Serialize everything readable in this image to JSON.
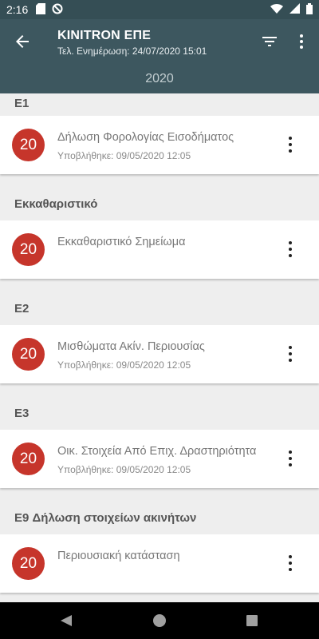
{
  "status_bar": {
    "time": "2:16",
    "icons": [
      "sd-card-icon",
      "no-disturb-icon",
      "wifi-icon",
      "signal-icon",
      "battery-icon"
    ]
  },
  "app_bar": {
    "title": "KINITRON ΕΠΕ",
    "subtitle": "Τελ. Ενημέρωση: 24/07/2020 15:01",
    "background_color": "#3d575f"
  },
  "year_tab": {
    "label": "2020"
  },
  "badge_color": "#c6352b",
  "sections": [
    {
      "header": "E1",
      "items": [
        {
          "badge": "20",
          "title": "Δήλωση Φορολογίας Εισοδήματος",
          "subtitle": "Υποβλήθηκε: 09/05/2020 12:05"
        }
      ]
    },
    {
      "header": "Εκκαθαριστικό",
      "items": [
        {
          "badge": "20",
          "title": "Εκκαθαριστικό Σημείωμα",
          "subtitle": ""
        }
      ]
    },
    {
      "header": "E2",
      "items": [
        {
          "badge": "20",
          "title": "Μισθώματα Ακίν. Περιουσίας",
          "subtitle": "Υποβλήθηκε: 09/05/2020 12:05"
        }
      ]
    },
    {
      "header": "E3",
      "items": [
        {
          "badge": "20",
          "title": "Οικ. Στοιχεία Από Επιχ. Δραστηριότητα",
          "subtitle": "Υποβλήθηκε: 09/05/2020 12:05"
        }
      ]
    },
    {
      "header": "E9 Δήλωση στοιχείων ακινήτων",
      "items": [
        {
          "badge": "20",
          "title": "Περιουσιακή κατάσταση",
          "subtitle": ""
        }
      ]
    }
  ]
}
